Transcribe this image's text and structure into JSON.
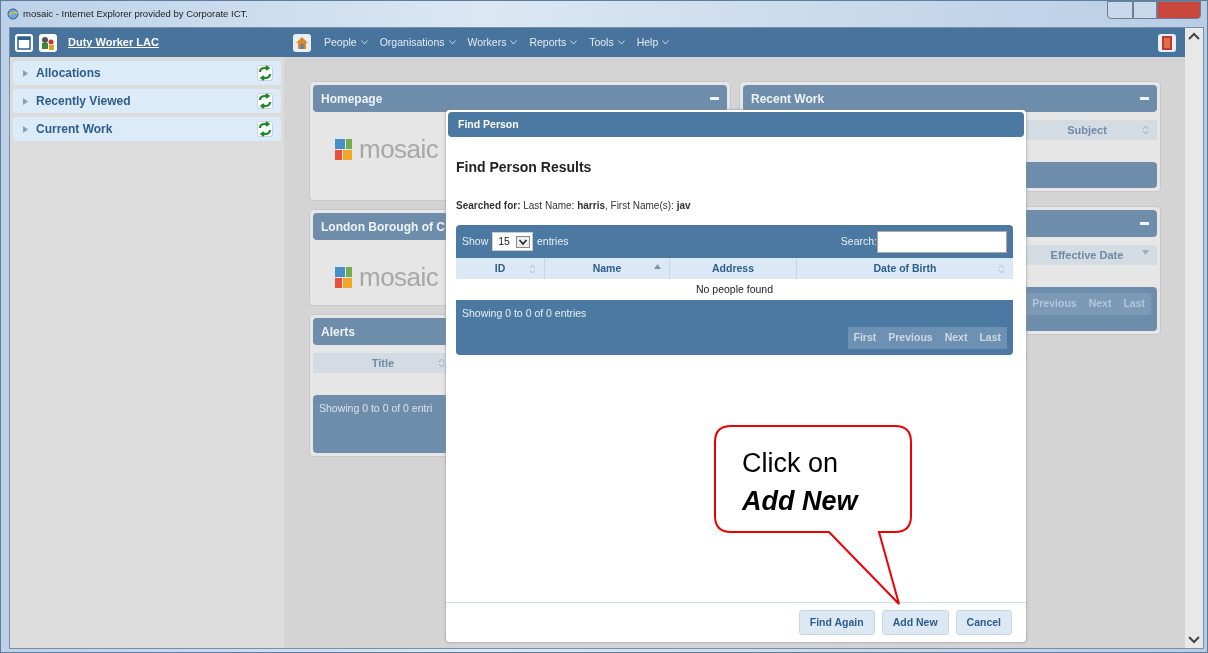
{
  "window": {
    "title": "mosaic - Internet Explorer provided by Corporate ICT."
  },
  "app_header": {
    "user": "Duty Worker LAC",
    "menu": [
      "People",
      "Organisations",
      "Workers",
      "Reports",
      "Tools",
      "Help"
    ]
  },
  "sidebar": {
    "items": [
      {
        "label": "Allocations",
        "expanded": false
      },
      {
        "label": "Recently Viewed",
        "expanded": false
      },
      {
        "label": "Current Work",
        "expanded": false
      }
    ]
  },
  "panels_left": [
    {
      "kind": "logo",
      "title": "Homepage",
      "collapsible": true,
      "logo_text": "mosaic"
    },
    {
      "kind": "logo",
      "title": "London Borough of C",
      "logo_text": "mosaic"
    },
    {
      "kind": "table",
      "title": "Alerts",
      "columns": [
        {
          "label": "Title",
          "kind": "both"
        }
      ],
      "info": "Showing 0 to 0 of 0 entri"
    }
  ],
  "panels_right": [
    {
      "kind": "table",
      "title": "Recent Work",
      "collapsible": true,
      "columns": [
        {
          "label": "Subject",
          "kind": "both"
        }
      ]
    },
    {
      "kind": "table",
      "collapsible": true,
      "columns": [
        {
          "label": "Effective Date",
          "kind": "desc"
        }
      ],
      "pager": [
        "Previous",
        "Next",
        "Last"
      ]
    }
  ],
  "dialog": {
    "title": "Find Person",
    "heading": "Find Person Results",
    "searched_for": "**Searched for:** Last Name: **harris**, First Name(s): **jav**",
    "table": {
      "show_label": "Show",
      "page_length": "15",
      "entries_label": "entries",
      "search_label": "Search:",
      "columns": [
        {
          "label": "ID",
          "kind": "both"
        },
        {
          "label": "Name",
          "kind": "asc"
        },
        {
          "label": "Address",
          "kind": "plain"
        },
        {
          "label": "Date of Birth",
          "kind": "both"
        }
      ],
      "empty_message": "No people found",
      "info": "Showing 0 to 0 of 0 entries",
      "pager": [
        "First",
        "Previous",
        "Next",
        "Last"
      ]
    },
    "buttons": [
      "Find Again",
      "Add New",
      "Cancel"
    ]
  },
  "callout": {
    "lines": [
      "Click on",
      "Add New"
    ]
  }
}
